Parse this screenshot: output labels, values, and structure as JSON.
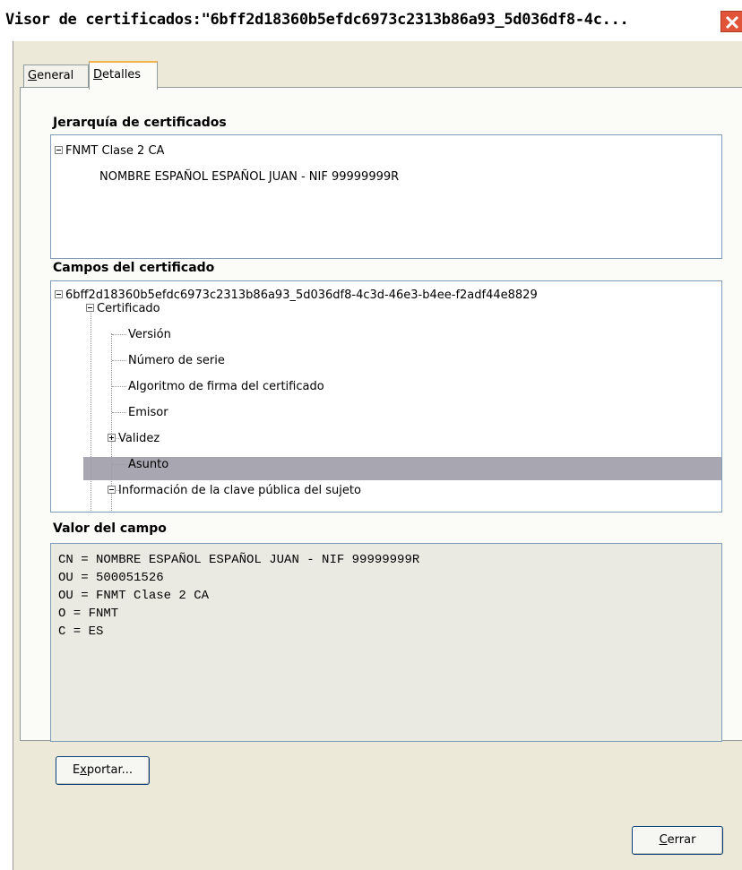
{
  "window": {
    "title": "Visor de certificados:\"6bff2d18360b5efdc6973c2313b86a93_5d036df8-4c..."
  },
  "tabs": [
    {
      "label_key": "G",
      "label_rest": "eneral",
      "active": false
    },
    {
      "label_key": "D",
      "label_rest": "etalles",
      "active": true
    }
  ],
  "hierarchy": {
    "label": "Jerarquía de certificados",
    "root": "FNMT Clase 2 CA",
    "child": "NOMBRE ESPAÑOL ESPAÑOL JUAN - NIF 99999999R"
  },
  "fields": {
    "label": "Campos del certificado",
    "items": [
      "6bff2d18360b5efdc6973c2313b86a93_5d036df8-4c3d-46e3-b4ee-f2adf44e8829",
      "Certificado",
      "Versión",
      "Número de serie",
      "Algoritmo de firma del certificado",
      "Emisor",
      "Validez",
      "Asunto",
      "Información de la clave pública del sujeto"
    ],
    "selected": "Asunto"
  },
  "value": {
    "label": "Valor del campo",
    "lines": [
      "CN = NOMBRE ESPAÑOL ESPAÑOL JUAN - NIF 99999999R",
      "OU = 500051526",
      "OU = FNMT Clase 2 CA",
      "O = FNMT",
      "C = ES"
    ]
  },
  "buttons": {
    "export_pre": "E",
    "export_key": "x",
    "export_rest": "portar...",
    "close_key": "C",
    "close_rest": "errar"
  },
  "icons": {
    "close": "close-icon",
    "collapse": "collapse-icon",
    "expand": "expand-icon",
    "scroll_up": "arrow-up-icon",
    "scroll_down": "arrow-down-icon"
  },
  "colors": {
    "close_button": "#e0553a",
    "selection": "#a7a6b1",
    "dialog_background": "#ece9d8",
    "active_tab_accent": "#f3b34a"
  }
}
